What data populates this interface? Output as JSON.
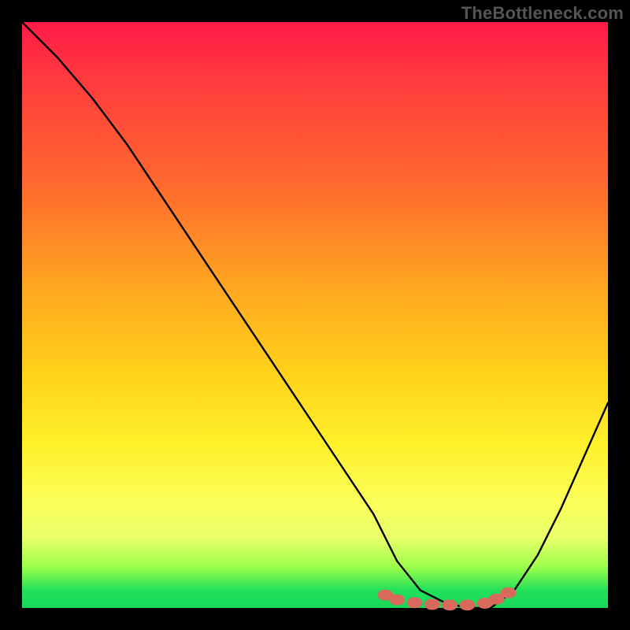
{
  "watermark": "TheBottleneck.com",
  "chart_data": {
    "type": "line",
    "title": "",
    "xlabel": "",
    "ylabel": "",
    "xlim": [
      0,
      100
    ],
    "ylim": [
      0,
      100
    ],
    "grid": false,
    "legend": false,
    "series": [
      {
        "name": "bottleneck-curve",
        "color": "#000000",
        "x": [
          0,
          6,
          12,
          18,
          24,
          30,
          36,
          42,
          48,
          54,
          60,
          64,
          68,
          72,
          76,
          80,
          84,
          88,
          92,
          96,
          100
        ],
        "y": [
          100,
          94,
          87,
          79,
          70,
          61,
          52,
          43,
          34,
          25,
          16,
          8,
          3,
          1,
          0,
          0,
          3,
          9,
          17,
          26,
          35
        ]
      }
    ],
    "markers": [
      {
        "name": "trough-point",
        "x": 62,
        "y": 2.2,
        "color": "#d86a5d"
      },
      {
        "name": "trough-point",
        "x": 64,
        "y": 1.4,
        "color": "#d86a5d"
      },
      {
        "name": "trough-point",
        "x": 67,
        "y": 0.9,
        "color": "#d86a5d"
      },
      {
        "name": "trough-point",
        "x": 70,
        "y": 0.6,
        "color": "#d86a5d"
      },
      {
        "name": "trough-point",
        "x": 73,
        "y": 0.5,
        "color": "#d86a5d"
      },
      {
        "name": "trough-point",
        "x": 76,
        "y": 0.5,
        "color": "#d86a5d"
      },
      {
        "name": "trough-point",
        "x": 79,
        "y": 0.8,
        "color": "#d86a5d"
      },
      {
        "name": "trough-point",
        "x": 81,
        "y": 1.5,
        "color": "#d86a5d"
      },
      {
        "name": "trough-point",
        "x": 83,
        "y": 2.6,
        "color": "#d86a5d"
      }
    ],
    "background_gradient": {
      "orientation": "vertical",
      "stops": [
        {
          "pos": 0.0,
          "color": "#ff1a47"
        },
        {
          "pos": 0.45,
          "color": "#ffa621"
        },
        {
          "pos": 0.72,
          "color": "#fff02a"
        },
        {
          "pos": 0.97,
          "color": "#22e05a"
        },
        {
          "pos": 1.0,
          "color": "#17d85a"
        }
      ]
    }
  }
}
